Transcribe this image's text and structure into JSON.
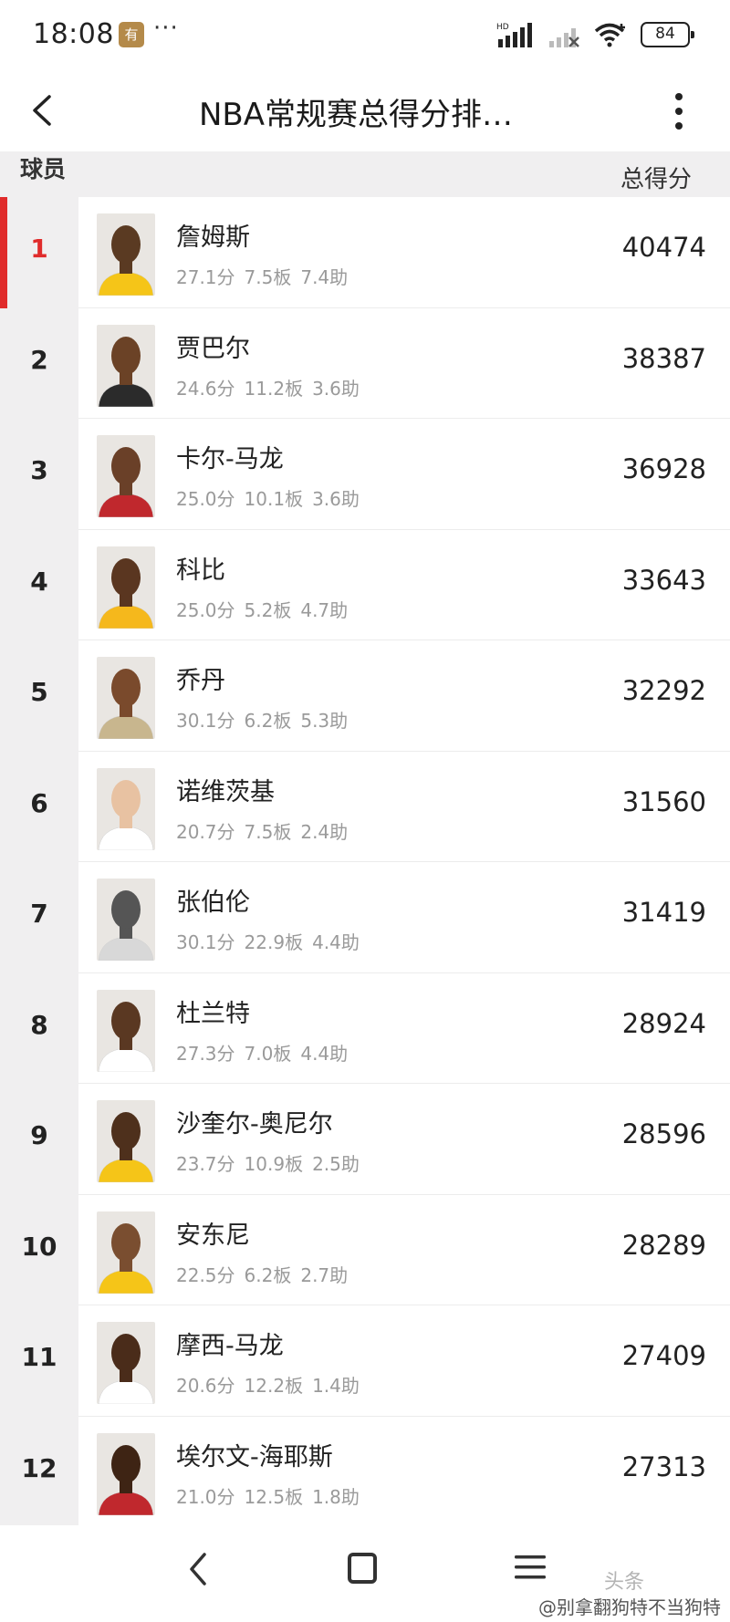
{
  "status_bar": {
    "time": "18:08",
    "app_badge": "有品",
    "more_dots": "···",
    "battery": "84"
  },
  "nav": {
    "title": "NBA常规赛总得分排…"
  },
  "table": {
    "col_player": "球员",
    "col_total": "总得分"
  },
  "players": [
    {
      "rank": "1",
      "name": "詹姆斯",
      "pts": "27.1分",
      "reb": "7.5板",
      "ast": "7.4助",
      "total": "40474",
      "jersey": "#f5c518",
      "skin": "#5a3a22"
    },
    {
      "rank": "2",
      "name": "贾巴尔",
      "pts": "24.6分",
      "reb": "11.2板",
      "ast": "3.6助",
      "total": "38387",
      "jersey": "#2b2b2b",
      "skin": "#6b4226"
    },
    {
      "rank": "3",
      "name": "卡尔-马龙",
      "pts": "25.0分",
      "reb": "10.1板",
      "ast": "3.6助",
      "total": "36928",
      "jersey": "#c0282d",
      "skin": "#6a4028"
    },
    {
      "rank": "4",
      "name": "科比",
      "pts": "25.0分",
      "reb": "5.2板",
      "ast": "4.7助",
      "total": "33643",
      "jersey": "#f5b81c",
      "skin": "#5a3620"
    },
    {
      "rank": "5",
      "name": "乔丹",
      "pts": "30.1分",
      "reb": "6.2板",
      "ast": "5.3助",
      "total": "32292",
      "jersey": "#c8b68e",
      "skin": "#7a4a2c"
    },
    {
      "rank": "6",
      "name": "诺维茨基",
      "pts": "20.7分",
      "reb": "7.5板",
      "ast": "2.4助",
      "total": "31560",
      "jersey": "#ffffff",
      "skin": "#e8c2a2"
    },
    {
      "rank": "7",
      "name": "张伯伦",
      "pts": "30.1分",
      "reb": "22.9板",
      "ast": "4.4助",
      "total": "31419",
      "jersey": "#d8d8d8",
      "skin": "#555555"
    },
    {
      "rank": "8",
      "name": "杜兰特",
      "pts": "27.3分",
      "reb": "7.0板",
      "ast": "4.4助",
      "total": "28924",
      "jersey": "#ffffff",
      "skin": "#5a3822"
    },
    {
      "rank": "9",
      "name": "沙奎尔-奥尼尔",
      "pts": "23.7分",
      "reb": "10.9板",
      "ast": "2.5助",
      "total": "28596",
      "jersey": "#f5c518",
      "skin": "#4e301c"
    },
    {
      "rank": "10",
      "name": "安东尼",
      "pts": "22.5分",
      "reb": "6.2板",
      "ast": "2.7助",
      "total": "28289",
      "jersey": "#f5c518",
      "skin": "#7a4e30"
    },
    {
      "rank": "11",
      "name": "摩西-马龙",
      "pts": "20.6分",
      "reb": "12.2板",
      "ast": "1.4助",
      "total": "27409",
      "jersey": "#ffffff",
      "skin": "#4a2c1a"
    },
    {
      "rank": "12",
      "name": "埃尔文-海耶斯",
      "pts": "21.0分",
      "reb": "12.5板",
      "ast": "1.8助",
      "total": "27313",
      "jersey": "#c0282d",
      "skin": "#3e2414"
    }
  ],
  "watermark": {
    "logo": "头条",
    "text": "@别拿翻狗特不当狗特"
  },
  "colors": {
    "accent": "#e02b2b",
    "rank_bg": "#f0eff0"
  }
}
